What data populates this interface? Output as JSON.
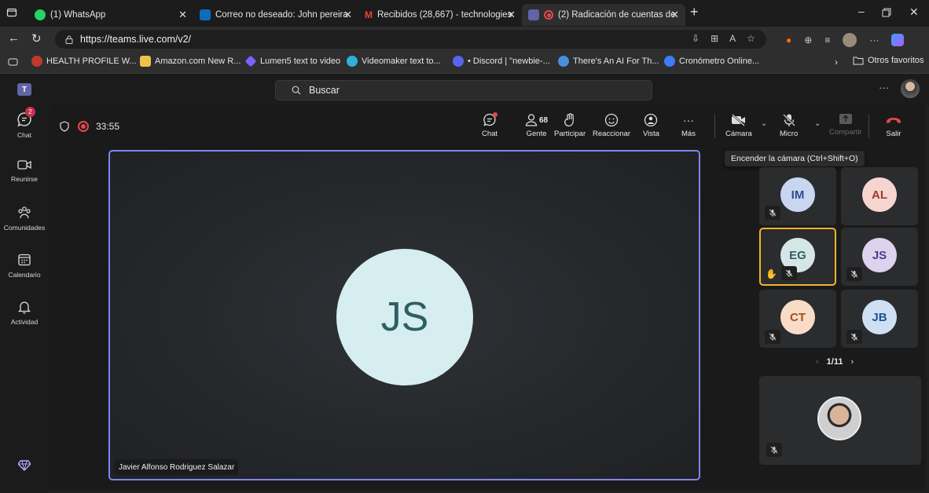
{
  "browser": {
    "tabs": [
      {
        "title": "(1) WhatsApp",
        "color": "#25d366"
      },
      {
        "title": "Correo no deseado: John pereira",
        "color": "#0f6cbd"
      },
      {
        "title": "Recibidos (28,667) - technologies",
        "color": "#ea4335"
      },
      {
        "title": "(2) Radicación de cuentas de",
        "color": "#6264a7"
      }
    ],
    "url": "https://teams.live.com/v2/",
    "favorites": [
      {
        "label": "HEALTH PROFILE W...",
        "color": "#c0392b"
      },
      {
        "label": "Amazon.com New R...",
        "color": "#f0c14b"
      },
      {
        "label": "Lumen5 text to video",
        "color": "#7b61ff"
      },
      {
        "label": "Videomaker text to...",
        "color": "#2fb0d8"
      },
      {
        "label": "• Discord | \"newbie-...",
        "color": "#5865f2"
      },
      {
        "label": "There's An AI For Th...",
        "color": "#4a90d9"
      },
      {
        "label": "Cronómetro Online...",
        "color": "#3d7cf5"
      }
    ],
    "other_favorites": "Otros favoritos"
  },
  "teams": {
    "search_placeholder": "Buscar",
    "rail": [
      {
        "label": "Chat",
        "icon": "chat-icon",
        "badge": "2"
      },
      {
        "label": "Reunirse",
        "icon": "video-icon"
      },
      {
        "label": "Comunidades",
        "icon": "communities-icon"
      },
      {
        "label": "Calendario",
        "icon": "calendar-icon"
      },
      {
        "label": "Actividad",
        "icon": "bell-icon"
      }
    ]
  },
  "meeting": {
    "timer": "33:55",
    "participants_count": "68",
    "toolbar": {
      "chat": "Chat",
      "people": "Gente",
      "raise": "Participar",
      "react": "Reaccionar",
      "view": "Vista",
      "more": "Más",
      "camera": "Cámara",
      "mic": "Micro",
      "share": "Compartir",
      "leave": "Salir"
    },
    "tooltip": "Encender la cámara (Ctrl+Shift+O)",
    "main": {
      "initials": "JS",
      "name": "Javier Alfonso Rodriguez Salazar"
    },
    "tiles": [
      {
        "initials": "IM",
        "bg": "#c9d6f2",
        "fg": "#2d4d8a"
      },
      {
        "initials": "AL",
        "bg": "#f6d5d0",
        "fg": "#a03c2c"
      },
      {
        "initials": "EG",
        "bg": "#d5e6e6",
        "fg": "#2f5f63"
      },
      {
        "initials": "JS",
        "bg": "#ddd3ef",
        "fg": "#4f3b85"
      },
      {
        "initials": "CT",
        "bg": "#f8dcc8",
        "fg": "#a4501a"
      },
      {
        "initials": "JB",
        "bg": "#cfe0f5",
        "fg": "#1f4f8f"
      }
    ],
    "page": "1/11",
    "accent": "#7f85f5",
    "leave_color": "#e5484d"
  }
}
